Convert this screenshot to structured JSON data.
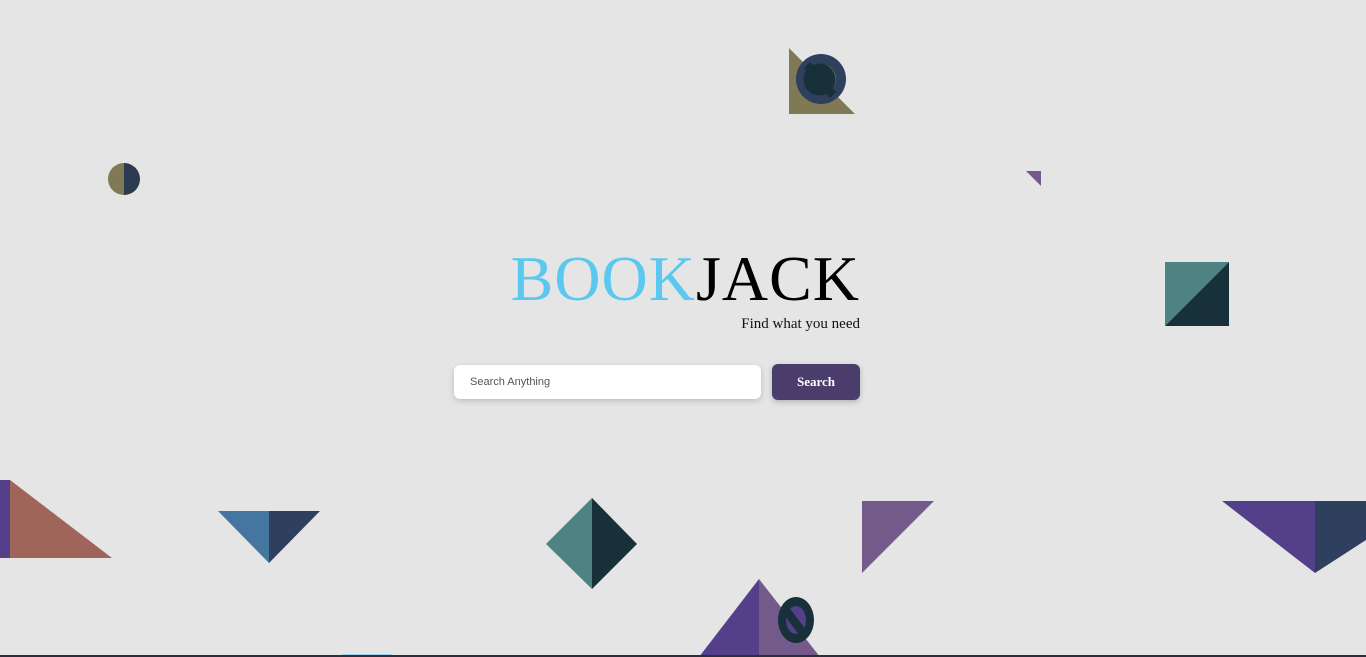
{
  "brand": {
    "logo_part1": "BOOK",
    "logo_part2": "JACK",
    "tagline": "Find what you need"
  },
  "search": {
    "placeholder": "Search Anything",
    "value": "",
    "button_label": "Search"
  },
  "colors": {
    "accent": "#5bc8ef",
    "button": "#4a3d6b",
    "background": "#e5e5e5"
  }
}
